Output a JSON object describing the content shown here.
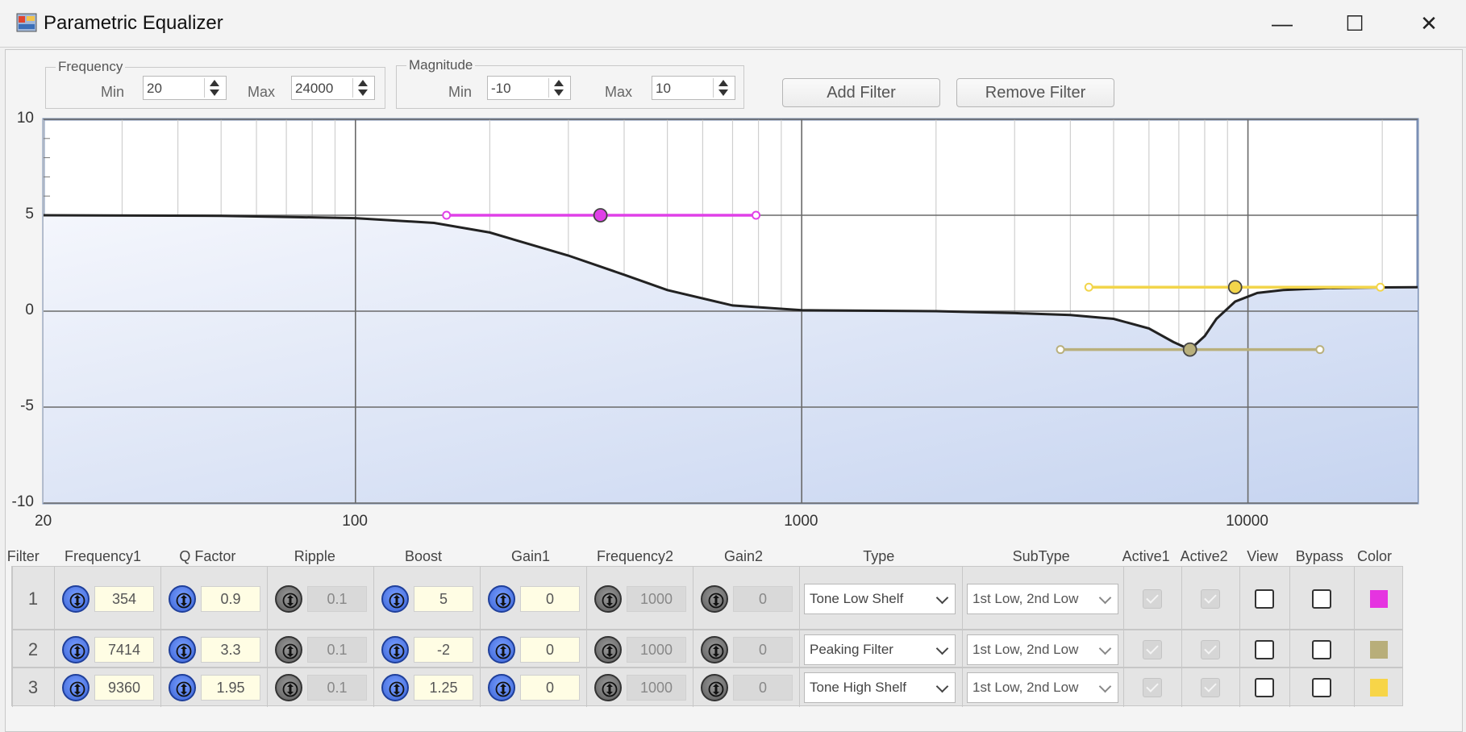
{
  "window": {
    "title": "Parametric Equalizer",
    "controls": [
      "—",
      "☐",
      "✕"
    ]
  },
  "frequency_group": {
    "legend": "Frequency",
    "min_label": "Min",
    "min_value": "20",
    "max_label": "Max",
    "max_value": "24000"
  },
  "magnitude_group": {
    "legend": "Magnitude",
    "min_label": "Min",
    "min_value": "-10",
    "max_label": "Max",
    "max_value": "10"
  },
  "buttons": {
    "add_filter": "Add Filter",
    "remove_filter": "Remove Filter"
  },
  "chart_data": {
    "type": "line",
    "x_scale": "log",
    "xlim": [
      20,
      24000
    ],
    "ylim": [
      -10,
      10
    ],
    "x_tick_labels": [
      "20",
      "100",
      "1000",
      "10000"
    ],
    "y_tick_labels": [
      "10",
      "5",
      "0",
      "-5",
      "-10"
    ],
    "grid": true,
    "response_curve": {
      "x": [
        20,
        50,
        100,
        150,
        200,
        300,
        400,
        500,
        700,
        1000,
        2000,
        3000,
        4000,
        5000,
        6000,
        6800,
        7414,
        8000,
        8500,
        9360,
        10500,
        12000,
        15000,
        20000,
        24000
      ],
      "y": [
        5.0,
        4.97,
        4.85,
        4.6,
        4.1,
        2.9,
        1.9,
        1.1,
        0.3,
        0.05,
        0.0,
        -0.1,
        -0.2,
        -0.4,
        -0.9,
        -1.6,
        -2.0,
        -1.3,
        -0.4,
        0.5,
        0.95,
        1.1,
        1.2,
        1.24,
        1.25
      ],
      "color": "#222222"
    },
    "filter_handles": [
      {
        "freq": 354,
        "gain": 5,
        "low": 160,
        "high": 790,
        "color": "#e040e8"
      },
      {
        "freq": 7414,
        "gain": -2,
        "low": 3800,
        "high": 14500,
        "color": "#b9b07c"
      },
      {
        "freq": 9360,
        "gain": 1.25,
        "low": 4400,
        "high": 19800,
        "color": "#f2d54b"
      }
    ]
  },
  "table": {
    "headers": [
      "Filter",
      "Frequency1",
      "Q Factor",
      "Ripple",
      "Boost",
      "Gain1",
      "Frequency2",
      "Gain2",
      "Type",
      "SubType",
      "Active1",
      "Active2",
      "View",
      "Bypass",
      "Color"
    ],
    "rows": [
      {
        "filter": "1",
        "frequency1": "354",
        "q_factor": "0.9",
        "ripple": "0.1",
        "boost": "5",
        "gain1": "0",
        "frequency2": "1000",
        "gain2": "0",
        "type": "Tone Low Shelf",
        "subtype": "1st Low, 2nd Low",
        "active1": true,
        "active2": true,
        "view": false,
        "bypass": false,
        "color": "#e534e0"
      },
      {
        "filter": "2",
        "frequency1": "7414",
        "q_factor": "3.3",
        "ripple": "0.1",
        "boost": "-2",
        "gain1": "0",
        "frequency2": "1000",
        "gain2": "0",
        "type": "Peaking Filter",
        "subtype": "1st Low, 2nd Low",
        "active1": true,
        "active2": true,
        "view": false,
        "bypass": false,
        "color": "#b8ae7a"
      },
      {
        "filter": "3",
        "frequency1": "9360",
        "q_factor": "1.95",
        "ripple": "0.1",
        "boost": "1.25",
        "gain1": "0",
        "frequency2": "1000",
        "gain2": "0",
        "type": "Tone High Shelf",
        "subtype": "1st Low, 2nd Low",
        "active1": true,
        "active2": true,
        "view": false,
        "bypass": false,
        "color": "#f7d548"
      }
    ]
  }
}
